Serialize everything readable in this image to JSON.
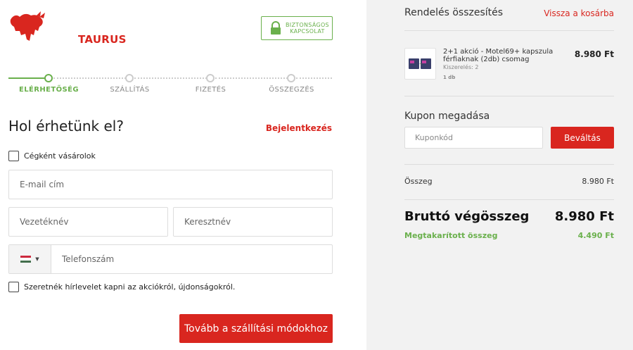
{
  "brand": {
    "name": "TAURUS",
    "accent": "#d9261f",
    "logo_icon": "bull-icon"
  },
  "secure_badge": {
    "line1": "BIZTONSÁGOS",
    "line2": "KAPCSOLAT",
    "icon": "lock-icon",
    "color": "#6ab04c"
  },
  "steps": [
    {
      "label": "ELÉRHETŐSÉG",
      "active": true
    },
    {
      "label": "SZÁLLÍTÁS",
      "active": false
    },
    {
      "label": "FIZETÉS",
      "active": false
    },
    {
      "label": "ÖSSZEGZÉS",
      "active": false
    }
  ],
  "form": {
    "title": "Hol érhetünk el?",
    "login_link": "Bejelentkezés",
    "company_checkbox": "Cégként vásárolok",
    "email_placeholder": "E-mail cím",
    "lastname_placeholder": "Vezetéknév",
    "firstname_placeholder": "Keresztnév",
    "phone_placeholder": "Telefonszám",
    "phone_country": "hungary-flag-icon",
    "newsletter_checkbox": "Szeretnék hírlevelet kapni az akciókról, újdonságokról.",
    "submit_label": "Tovább a szállítási módokhoz"
  },
  "summary": {
    "title": "Rendelés összesítés",
    "back_link": "Vissza a kosárba",
    "product": {
      "name": "2+1 akció - Motel69+ kapszula férfiaknak (2db) csomag",
      "variant": "Kiszerelés: 2",
      "qty": "1 db",
      "price": "8.980 Ft"
    },
    "coupon_title": "Kupon megadása",
    "coupon_placeholder": "Kuponkód",
    "coupon_button": "Beváltás",
    "subtotal_label": "Összeg",
    "subtotal_value": "8.980 Ft",
    "total_label": "Bruttó végösszeg",
    "total_value": "8.980 Ft",
    "savings_label": "Megtakarított összeg",
    "savings_value": "4.490 Ft"
  }
}
